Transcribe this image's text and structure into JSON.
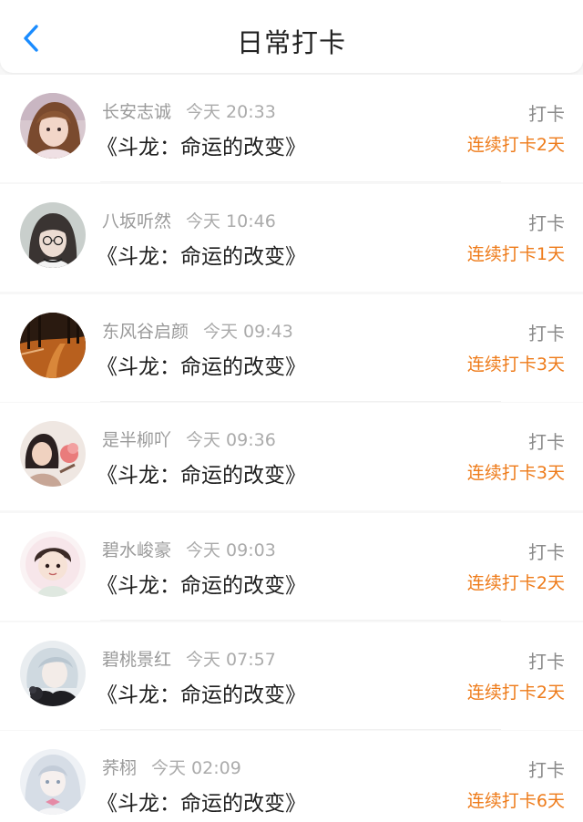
{
  "header": {
    "title": "日常打卡"
  },
  "colors": {
    "accent_blue": "#1a8cff",
    "streak_orange": "#ee7b1a"
  },
  "entries": [
    {
      "name": "长安志诚",
      "time": "今天 20:33",
      "title": "《斗龙：命运的改变》",
      "checkin": "打卡",
      "streak": "连续打卡2天"
    },
    {
      "name": "八坂听然",
      "time": "今天 10:46",
      "title": "《斗龙：命运的改变》",
      "checkin": "打卡",
      "streak": "连续打卡1天"
    },
    {
      "name": "东风谷启颜",
      "time": "今天 09:43",
      "title": "《斗龙：命运的改变》",
      "checkin": "打卡",
      "streak": "连续打卡3天"
    },
    {
      "name": "是半柳吖",
      "time": "今天 09:36",
      "title": "《斗龙：命运的改变》",
      "checkin": "打卡",
      "streak": "连续打卡3天"
    },
    {
      "name": "碧水峻豪",
      "time": "今天 09:03",
      "title": "《斗龙：命运的改变》",
      "checkin": "打卡",
      "streak": "连续打卡2天"
    },
    {
      "name": "碧桃景红",
      "time": "今天 07:57",
      "title": "《斗龙：命运的改变》",
      "checkin": "打卡",
      "streak": "连续打卡2天"
    },
    {
      "name": "荞栩",
      "time": "今天 02:09",
      "title": "《斗龙：命运的改变》",
      "checkin": "打卡",
      "streak": "连续打卡6天"
    }
  ]
}
